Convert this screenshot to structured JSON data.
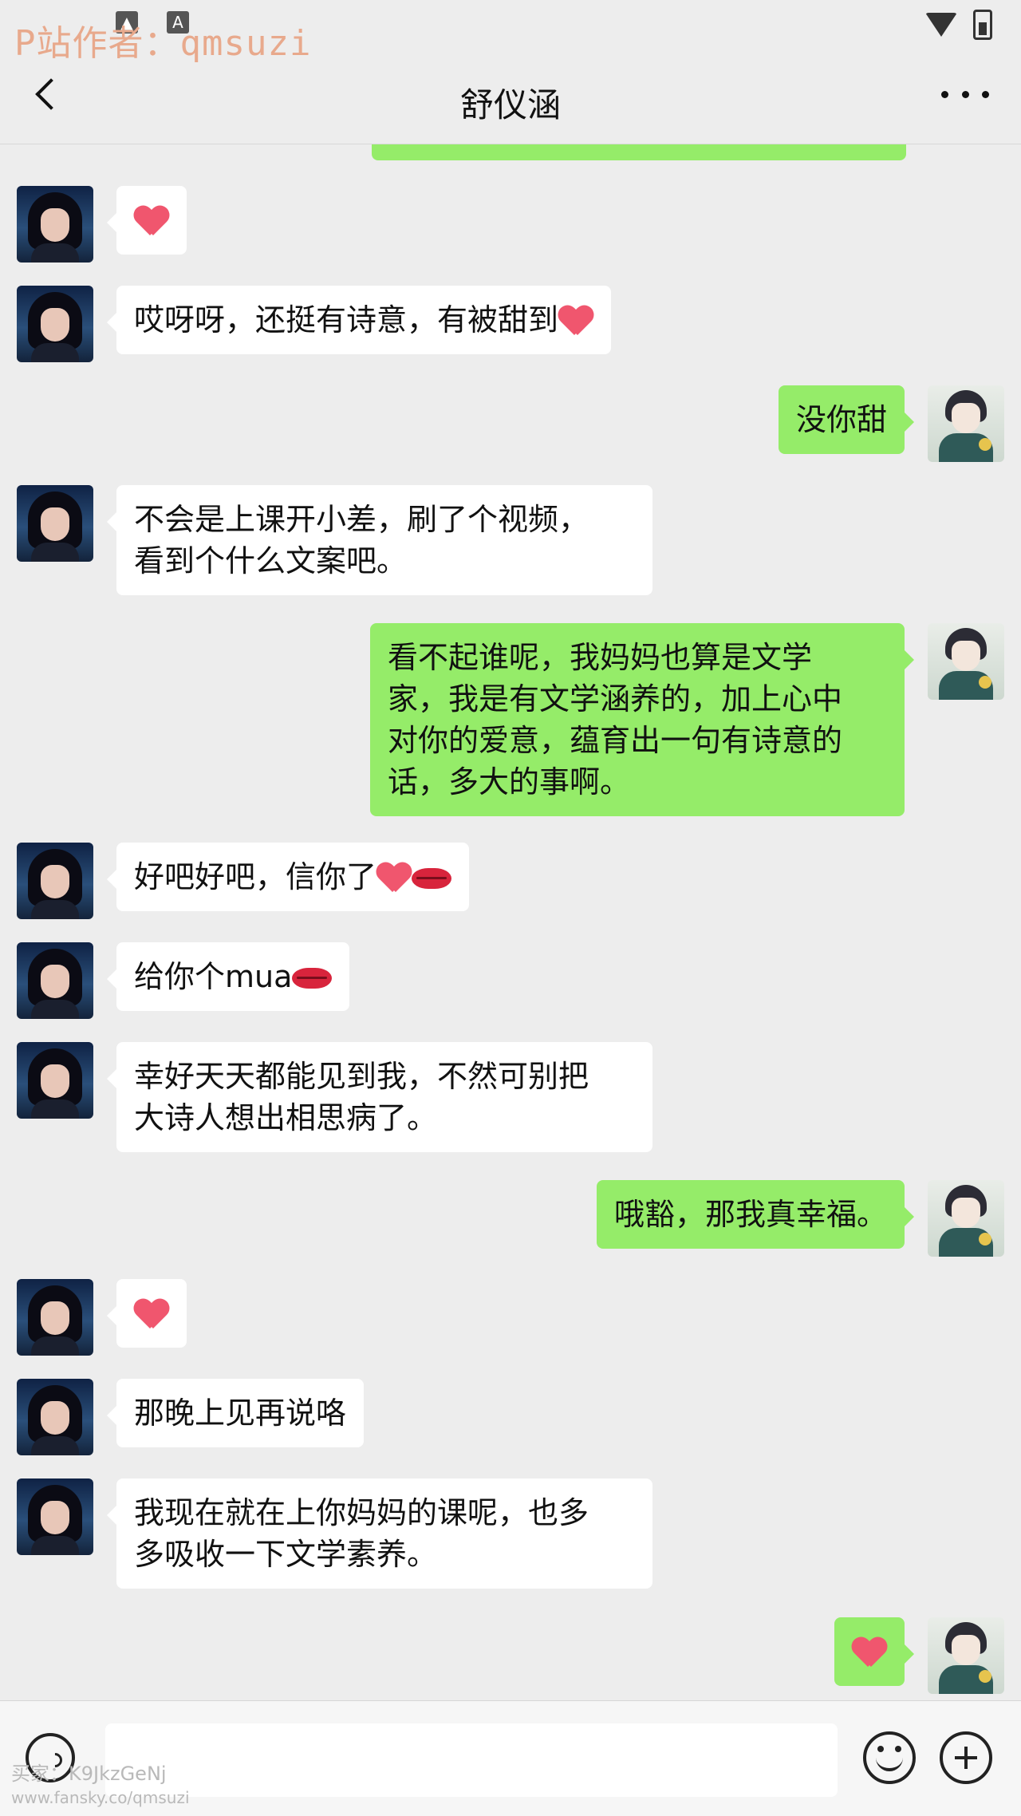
{
  "watermark": {
    "top": "P站作者：qmsuzi",
    "bottom_code": "买家：K9JkzGeNj",
    "bottom_url": "www.fansky.co/qmsuzi"
  },
  "status_bar": {
    "wifi": "wifi-icon",
    "battery": "battery-icon"
  },
  "header": {
    "title": "舒仪涵",
    "back_icon": "chevron-left-icon",
    "more_icon": "more-dots-icon"
  },
  "colors": {
    "sent_bubble": "#95ec69",
    "received_bubble": "#ffffff",
    "background": "#ededed",
    "heart": "#f0566e",
    "lips": "#d8243c"
  },
  "messages": [
    {
      "from": "contact",
      "text": "",
      "emoji_after": [
        "heart"
      ]
    },
    {
      "from": "contact",
      "text": "哎呀呀，还挺有诗意，有被甜到",
      "emoji_after": [
        "heart"
      ]
    },
    {
      "from": "me",
      "text": "没你甜"
    },
    {
      "from": "contact",
      "text": "不会是上课开小差，刷了个视频，\n看到个什么文案吧。"
    },
    {
      "from": "me",
      "text": "看不起谁呢，我妈妈也算是文学\n家，我是有文学涵养的，加上心中\n对你的爱意，蕴育出一句有诗意的\n话，多大的事啊。"
    },
    {
      "from": "contact",
      "text": "好吧好吧，信你了",
      "emoji_after": [
        "heart",
        "lips"
      ]
    },
    {
      "from": "contact",
      "text": "给你个mua",
      "emoji_after": [
        "lips"
      ]
    },
    {
      "from": "contact",
      "text": "幸好天天都能见到我，不然可别把\n大诗人想出相思病了。"
    },
    {
      "from": "me",
      "text": "哦豁，那我真幸福。"
    },
    {
      "from": "contact",
      "text": "",
      "emoji_after": [
        "heart"
      ]
    },
    {
      "from": "contact",
      "text": "那晚上见再说咯"
    },
    {
      "from": "contact",
      "text": "我现在就在上你妈妈的课呢，也多\n多吸收一下文学素养。"
    },
    {
      "from": "me",
      "text": "",
      "emoji_after": [
        "heart"
      ]
    }
  ],
  "input_bar": {
    "voice_icon": "voice-icon",
    "input_value": "",
    "emoji_icon": "emoji-icon",
    "plus_icon": "plus-icon"
  }
}
